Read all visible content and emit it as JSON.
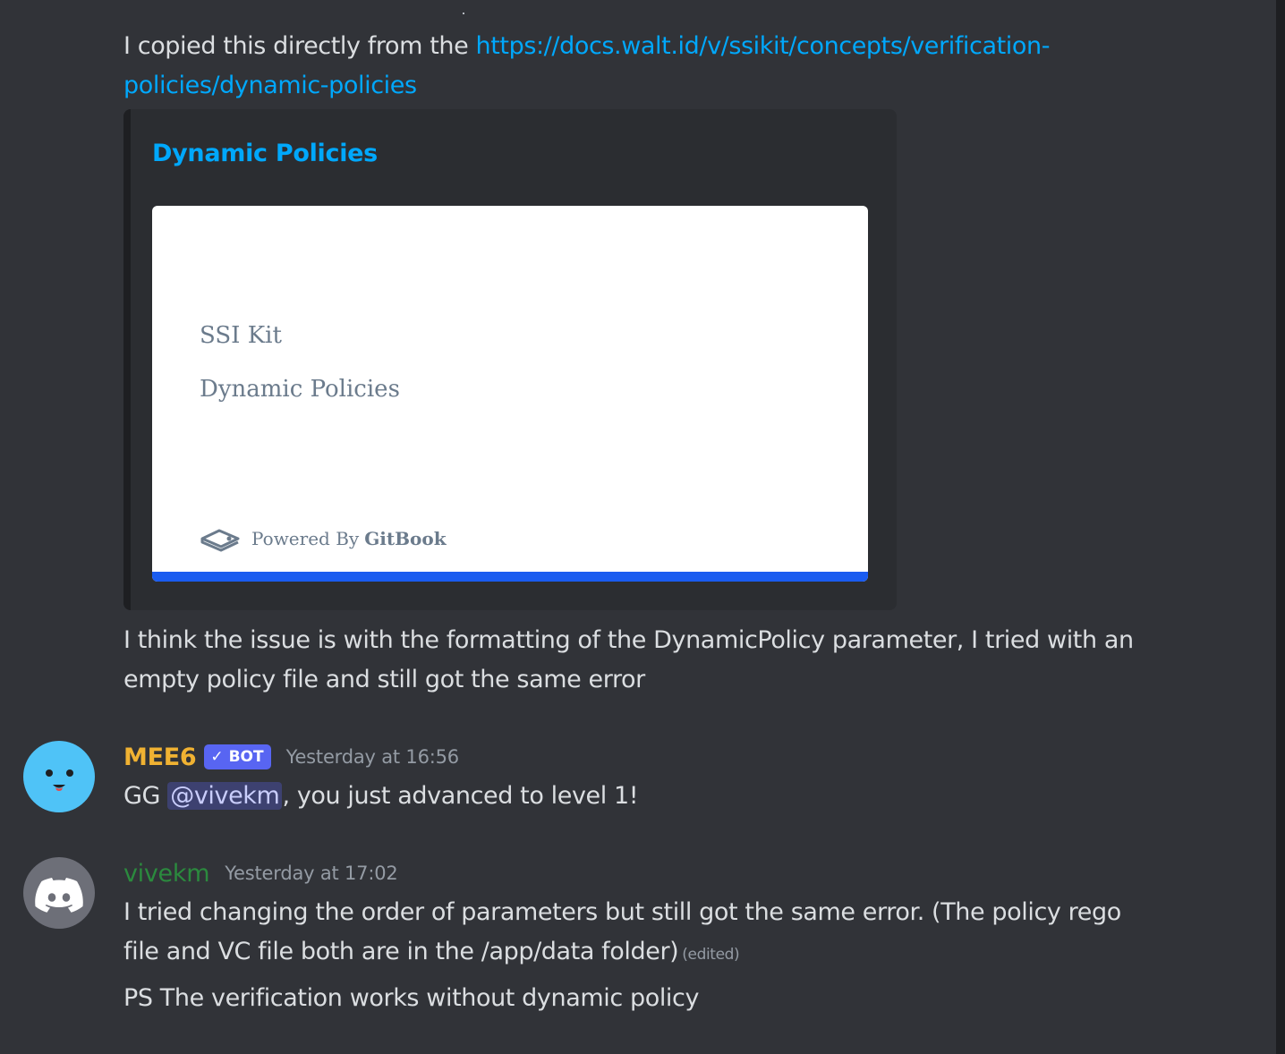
{
  "message1": {
    "text_before": "I copied this directly from the ",
    "link_line1": "https://docs.walt.id/v/ssikit/concepts/verification-",
    "link_line2": "policies/dynamic-policies"
  },
  "embed": {
    "title": "Dynamic Policies",
    "image": {
      "line1": "SSI Kit",
      "line2": "Dynamic Policies",
      "powered_prefix": "Powered By",
      "powered_brand": "GitBook"
    }
  },
  "message2": {
    "line1": "I think the issue is with the formatting of the DynamicPolicy parameter, I tried with an",
    "line2": "empty policy file and still got the same error"
  },
  "mee6_message": {
    "username": "MEE6",
    "username_color": "#f0b232",
    "bot_tag": "BOT",
    "timestamp": "Yesterday at 16:56",
    "text_prefix": "GG ",
    "mention": "@vivekm",
    "text_suffix": ", you just advanced to level 1!"
  },
  "vivekm_message": {
    "username": "vivekm",
    "username_color": "#2b8a3e",
    "timestamp": "Yesterday at 17:02",
    "line1": "I tried changing the order of parameters but still got the same error. (The policy rego",
    "line2": "file and VC file both are in the /app/data folder)",
    "edited": "(edited)",
    "line3": "PS The verification works without dynamic policy"
  },
  "colors": {
    "background": "#313338",
    "link": "#00a8fc",
    "bot_tag": "#5865f2",
    "gitbook_bar": "#1a5cf0"
  },
  "icons": [
    "mee6-avatar-icon",
    "discord-avatar-icon",
    "gitbook-icon",
    "check-icon"
  ]
}
